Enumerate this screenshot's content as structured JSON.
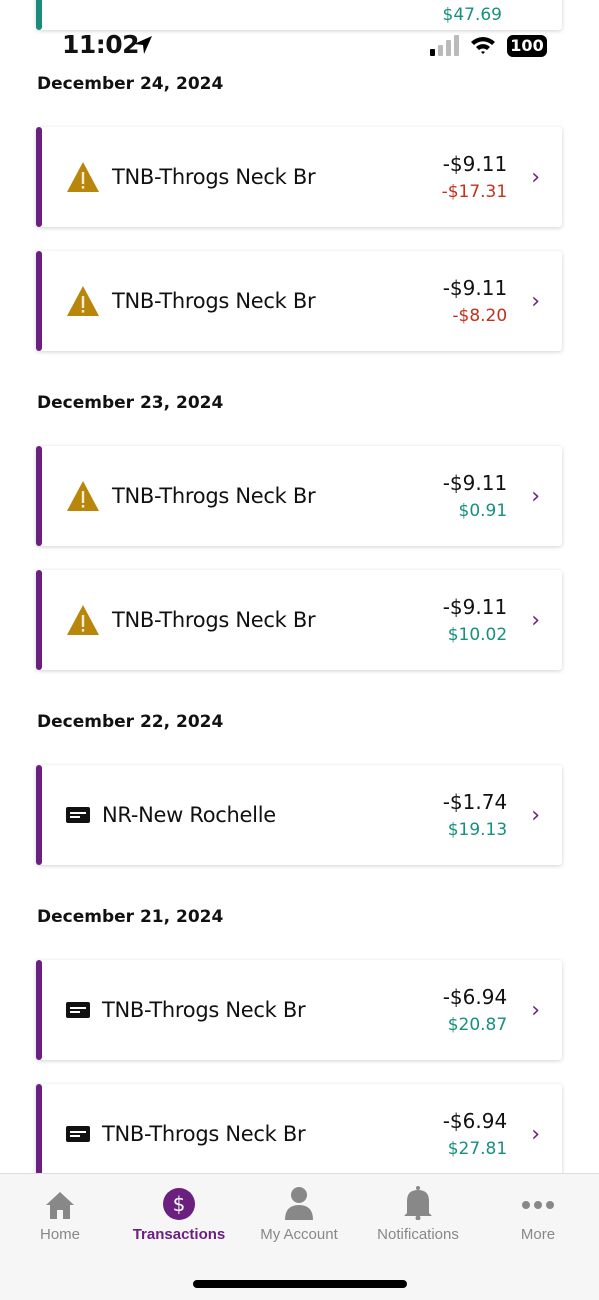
{
  "status_bar": {
    "time": "11:02",
    "battery": "100"
  },
  "partial_card": {
    "balance": "$47.69"
  },
  "groups": [
    {
      "date": "December 24, 2024",
      "items": [
        {
          "icon": "warning-icon",
          "name": "TNB-Throgs Neck Br",
          "amount": "-$9.11",
          "balance": "-$17.31",
          "balance_type": "neg"
        },
        {
          "icon": "warning-icon",
          "name": "TNB-Throgs Neck Br",
          "amount": "-$9.11",
          "balance": "-$8.20",
          "balance_type": "neg"
        }
      ]
    },
    {
      "date": "December 23, 2024",
      "items": [
        {
          "icon": "warning-icon",
          "name": "TNB-Throgs Neck Br",
          "amount": "-$9.11",
          "balance": "$0.91",
          "balance_type": "pos"
        },
        {
          "icon": "warning-icon",
          "name": "TNB-Throgs Neck Br",
          "amount": "-$9.11",
          "balance": "$10.02",
          "balance_type": "pos"
        }
      ]
    },
    {
      "date": "December 22, 2024",
      "items": [
        {
          "icon": "message-icon",
          "name": "NR-New Rochelle",
          "amount": "-$1.74",
          "balance": "$19.13",
          "balance_type": "pos"
        }
      ]
    },
    {
      "date": "December 21, 2024",
      "items": [
        {
          "icon": "message-icon",
          "name": "TNB-Throgs Neck Br",
          "amount": "-$6.94",
          "balance": "$20.87",
          "balance_type": "pos"
        },
        {
          "icon": "message-icon",
          "name": "TNB-Throgs Neck Br",
          "amount": "-$6.94",
          "balance": "$27.81",
          "balance_type": "pos"
        }
      ]
    }
  ],
  "tabs": [
    {
      "label": "Home",
      "icon": "home-icon"
    },
    {
      "label": "Transactions",
      "icon": "dollar-icon",
      "active": true
    },
    {
      "label": "My Account",
      "icon": "person-icon"
    },
    {
      "label": "Notifications",
      "icon": "bell-icon"
    },
    {
      "label": "More",
      "icon": "more-icon"
    }
  ],
  "colors": {
    "accent": "#6b1f7f",
    "negative": "#c4311a",
    "positive": "#16907f",
    "warning": "#b8860b"
  }
}
